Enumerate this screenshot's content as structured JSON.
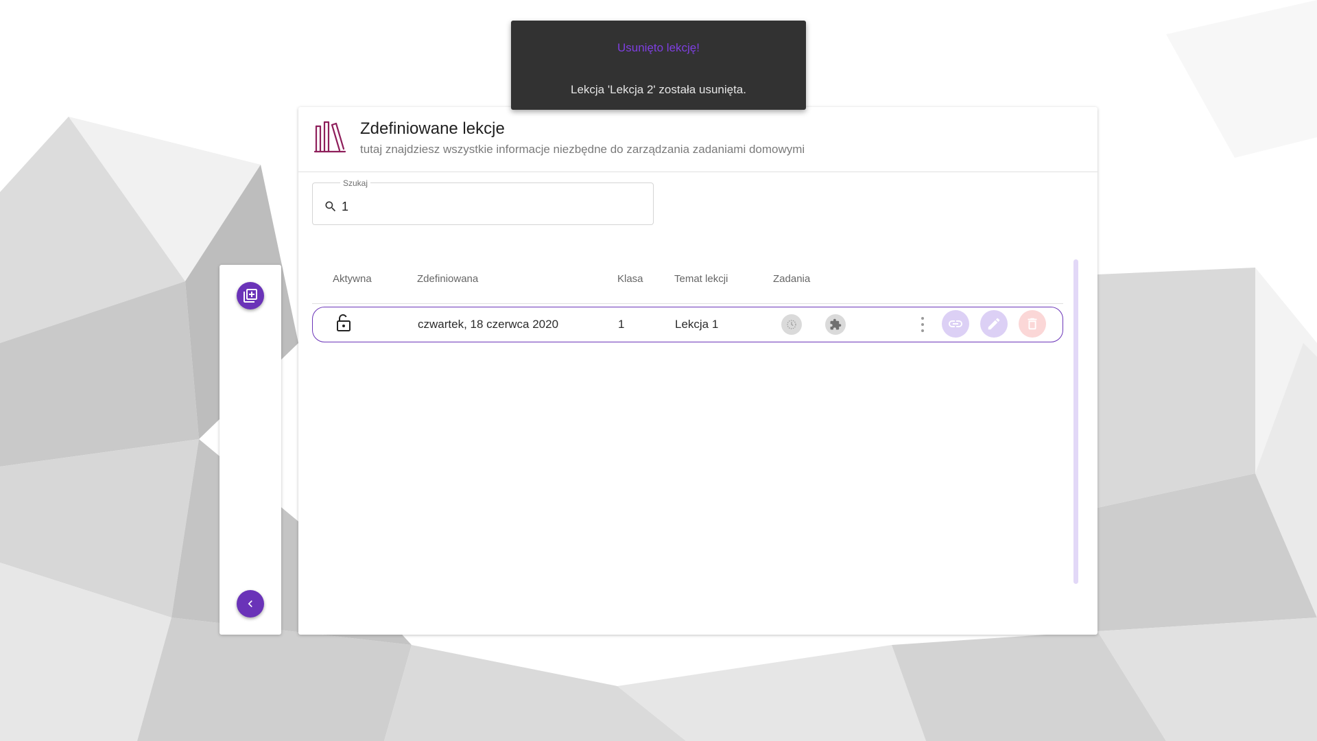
{
  "toast": {
    "title": "Usunięto lekcję!",
    "message": "Lekcja 'Lekcja 2' została usunięta."
  },
  "header": {
    "title": "Zdefiniowane lekcje",
    "subtitle": "tutaj znajdziesz wszystkie informacje niezbędne do zarządzania zadaniami domowymi",
    "icon": "books-icon"
  },
  "search": {
    "label": "Szukaj",
    "value": "1"
  },
  "table": {
    "columns": [
      "Aktywna",
      "Zdefiniowana",
      "Klasa",
      "Temat lekcji",
      "Zadania"
    ],
    "rows": [
      {
        "active_icon": "unlocked-icon",
        "defined": "czwartek, 18 czerwca 2020",
        "class": "1",
        "topic": "Lekcja 1",
        "tasks_icons": [
          "clock-icon",
          "puzzle-icon"
        ]
      }
    ]
  },
  "sidebar": {
    "add_icon": "add-library-icon",
    "collapse_icon": "chevron-left-icon"
  },
  "colors": {
    "accent": "#6a33b8",
    "toast_bg": "#323232",
    "toast_title": "#7e3fe0",
    "delete_tint": "#fbd7d7",
    "action_tint": "#dcd0f5"
  }
}
